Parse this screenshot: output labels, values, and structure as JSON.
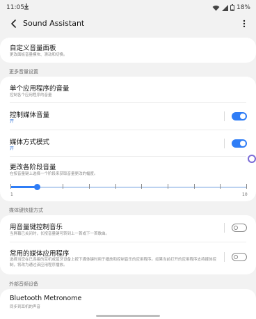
{
  "status_bar": {
    "time": "11:05",
    "download_icon": "download-icon",
    "battery": "18%"
  },
  "app_bar": {
    "title": "Sound Assistant",
    "back_icon": "back-arrow-icon",
    "more_icon": "more-vert-icon"
  },
  "custom_panel": {
    "title": "自定义音量面板",
    "subtitle": "更改面板音量模块、滑动和切换。"
  },
  "more_volume_settings": {
    "label": "更多音量设置",
    "items": [
      {
        "title": "单个应用程序的音量",
        "subtitle": "控制各个应用程序的音量"
      },
      {
        "title": "控制媒体音量",
        "subtitle": "开",
        "toggle": true
      },
      {
        "title": "媒体方式模式",
        "subtitle": "开",
        "toggle": true
      },
      {
        "title": "更改各阶段音量",
        "subtitle": "在按音量键上选择一个阶段来获取音量更改的幅度。"
      }
    ],
    "slider": {
      "min_label": "1",
      "max_label": "10",
      "value": 2,
      "min": 1,
      "max": 10
    }
  },
  "media_shortcut": {
    "label": "媒体键快捷方式",
    "items": [
      {
        "title": "用音量键控制音乐",
        "subtitle": "当屏幕已关闭时，长按音量键可转到上一首或下一首歌曲。",
        "toggle": false
      },
      {
        "title": "常用的媒体应用程序",
        "subtitle": "选择当您在已连接的耳机或蓝牙设备上按下媒体键时用于播放和控制音乐的应用程序。如果当前打开的应用程序支持媒体控制，将改为通过该应用程序播放。",
        "toggle": false
      }
    ]
  },
  "external_devices": {
    "label": "外部音频设备",
    "items": [
      {
        "title": "Bluetooth Metronome",
        "subtitle": "同步到耳机的声音"
      }
    ]
  },
  "colors": {
    "accent": "#2f7df6",
    "background": "#f2f2f2",
    "card": "#ffffff"
  }
}
